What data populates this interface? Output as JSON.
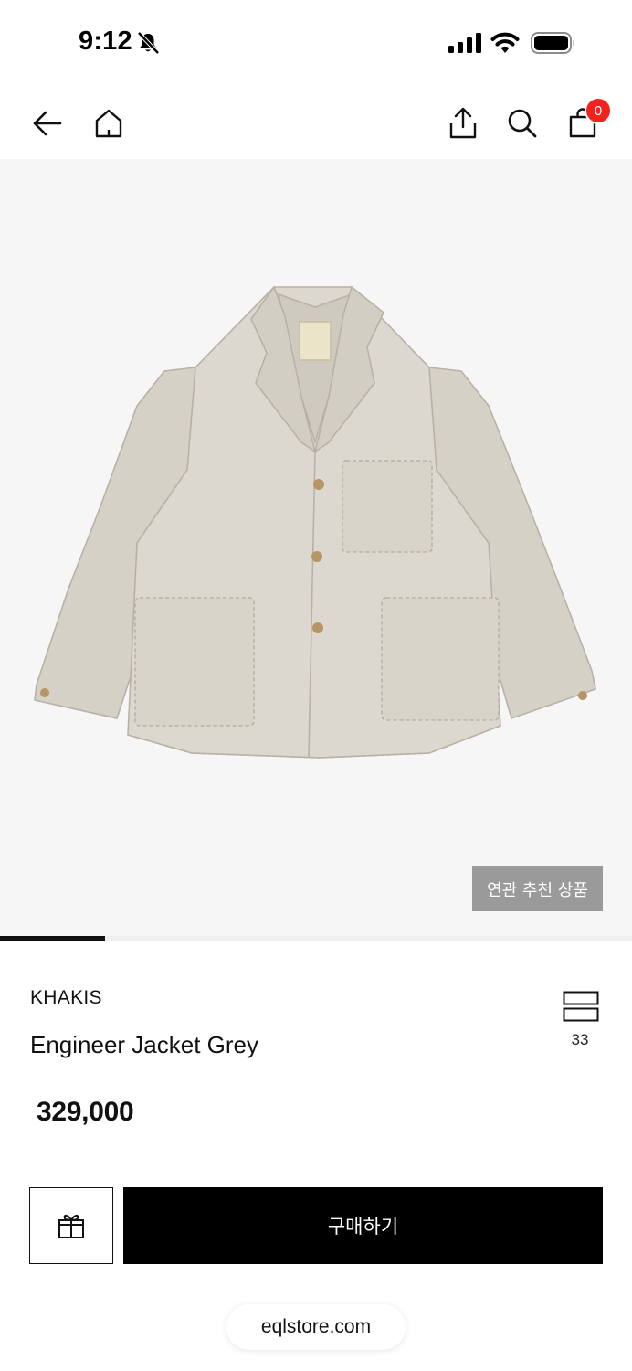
{
  "status_bar": {
    "time": "9:12",
    "icons": [
      "bell-slash-icon",
      "cellular-signal-icon",
      "wifi-icon",
      "battery-icon"
    ]
  },
  "nav": {
    "icons": [
      "back-arrow-icon",
      "home-icon",
      "share-icon",
      "search-icon",
      "shopping-bag-icon"
    ],
    "cart_count": "0",
    "badge_color": "#f2231f"
  },
  "product": {
    "image_alt_icon": "jacket-image",
    "related_label": "연관 추천 상품",
    "image_progress": 0.166,
    "brand": "KHAKIS",
    "name": "Engineer Jacket Grey",
    "price": "329,000",
    "wishlist_count": "33"
  },
  "actions": {
    "gift_icon": "gift-icon",
    "buy_label": "구매하기"
  },
  "browser": {
    "url": "eqlstore.com"
  },
  "colors": {
    "image_background": "#f6f6f7",
    "jacket": "#d9d5cc",
    "buy_button": "#000000"
  }
}
